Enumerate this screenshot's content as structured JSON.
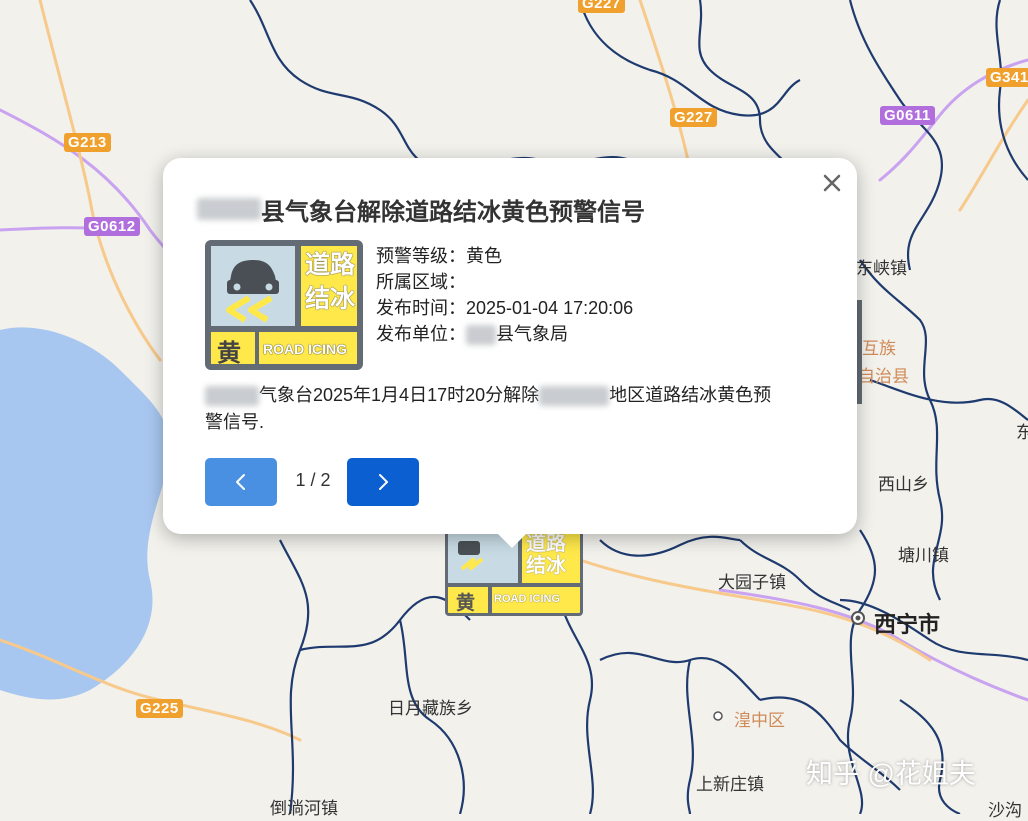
{
  "map": {
    "road_shields": [
      {
        "label": "G227",
        "kind": "national"
      },
      {
        "label": "G213",
        "kind": "national"
      },
      {
        "label": "G0612",
        "kind": "expressway"
      },
      {
        "label": "G227",
        "kind": "national"
      },
      {
        "label": "G0611",
        "kind": "expressway"
      },
      {
        "label": "G341",
        "kind": "national"
      },
      {
        "label": "G225",
        "kind": "national"
      }
    ],
    "place_labels": {
      "dongxia": "东峡镇",
      "huzhu": "互族",
      "zizhixian": "自治县",
      "xishan": "西山乡",
      "tangchuan": "塘川镇",
      "dayuanzi": "大园子镇",
      "xining": "西宁市",
      "riyue": "日月藏族乡",
      "huangzhong": "湟中区",
      "shangxinzhuang": "上新庄镇",
      "daotanghe": "倒淌河镇",
      "shahe": "沙沟",
      "dong": "东"
    },
    "watermark": "知乎 @花姐夫",
    "colors": {
      "land": "#f2f1ec",
      "lake": "#a8c7f0",
      "boundary": "#1e3a6e",
      "expressway": "#c9a3f0",
      "national_road": "#f7c98a"
    }
  },
  "marker": {
    "level_char": "黄",
    "road_text": "ROAD ICING",
    "title_chars": "道路结冰"
  },
  "popup": {
    "title_suffix": "县气象台解除道路结冰黄色预警信号",
    "fields": [
      {
        "label": "预警等级：",
        "value": "黄色"
      },
      {
        "label": "所属区域：",
        "value": ""
      },
      {
        "label": "发布时间：",
        "value": "2025-01-04 17:20:06"
      },
      {
        "label": "发布单位：",
        "value": "县气象局"
      }
    ],
    "desc_part1": "气象台2025年1月4日17时20分解除",
    "desc_part2": "地区道路结冰黄色预",
    "desc_part3": "警信号.",
    "icon": {
      "level_char": "黄",
      "road_text": "ROAD ICING",
      "title_chars": "道路结冰",
      "colors": {
        "frame": "#636b75",
        "yellow": "#ffe94a",
        "sky": "#c8dbe4"
      }
    },
    "pager": "1 / 2",
    "prev_icon": "chevron-left-icon",
    "next_icon": "chevron-right-icon",
    "close_icon": "close-icon"
  }
}
